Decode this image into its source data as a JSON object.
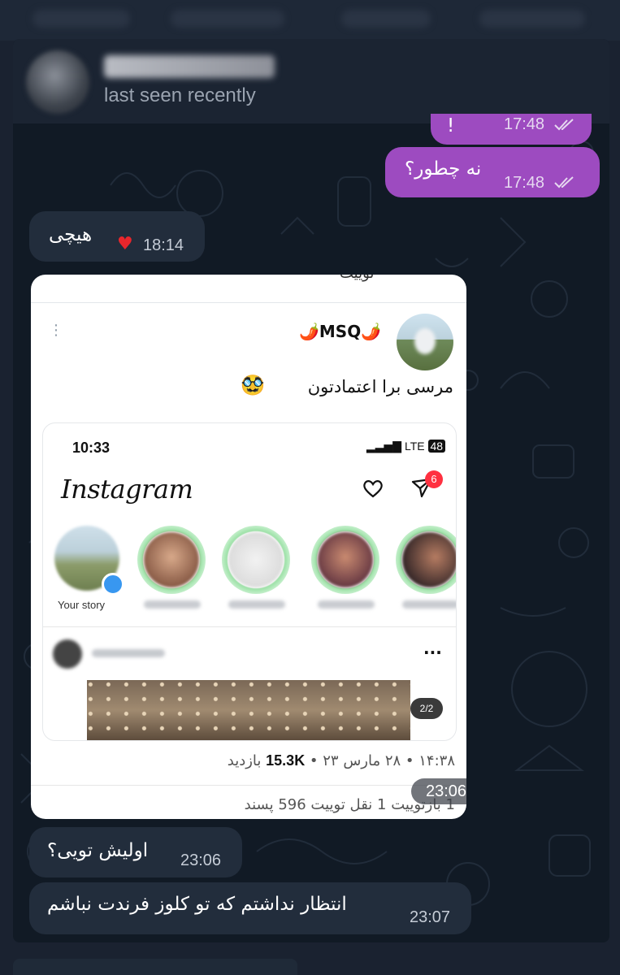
{
  "header": {
    "last_seen": "last seen recently"
  },
  "messages": {
    "m1": {
      "text": "!",
      "time": "17:48",
      "status": "read"
    },
    "m2": {
      "text": "نه چطور؟",
      "time": "17:48",
      "status": "read"
    },
    "m3": {
      "text": "هیچی",
      "time": "18:14",
      "reaction": "heart"
    },
    "m4": {
      "time": "23:06",
      "tweet": {
        "header_text": "توییت",
        "author": "🌶️MSQ🌶️",
        "text": "مرسی برا اعتمادتون",
        "emoji": "🥸😄",
        "instagram": {
          "time": "10:33",
          "network": "LTE",
          "battery": "48",
          "logo": "Instagram",
          "badge": "6",
          "your_story": "Your story",
          "counter": "2/2"
        },
        "meta": "۱۴:۳۸ • ۲۸ مارس ۲۳ • ",
        "views_value": "15.3K",
        "views_label": " بازدید",
        "stats": "1 بازتوییت   1 نقل توییت   596 پسند"
      }
    },
    "m5": {
      "text": "اولیش تویی؟",
      "time": "23:06"
    },
    "m6": {
      "text": "انتظار نداشتم که تو کلوز فرندت نباشم",
      "time": "23:07"
    }
  },
  "colors": {
    "outgoing_bubble": "#9d4bc0",
    "incoming_bubble": "#222d3c",
    "background": "#111a25"
  }
}
